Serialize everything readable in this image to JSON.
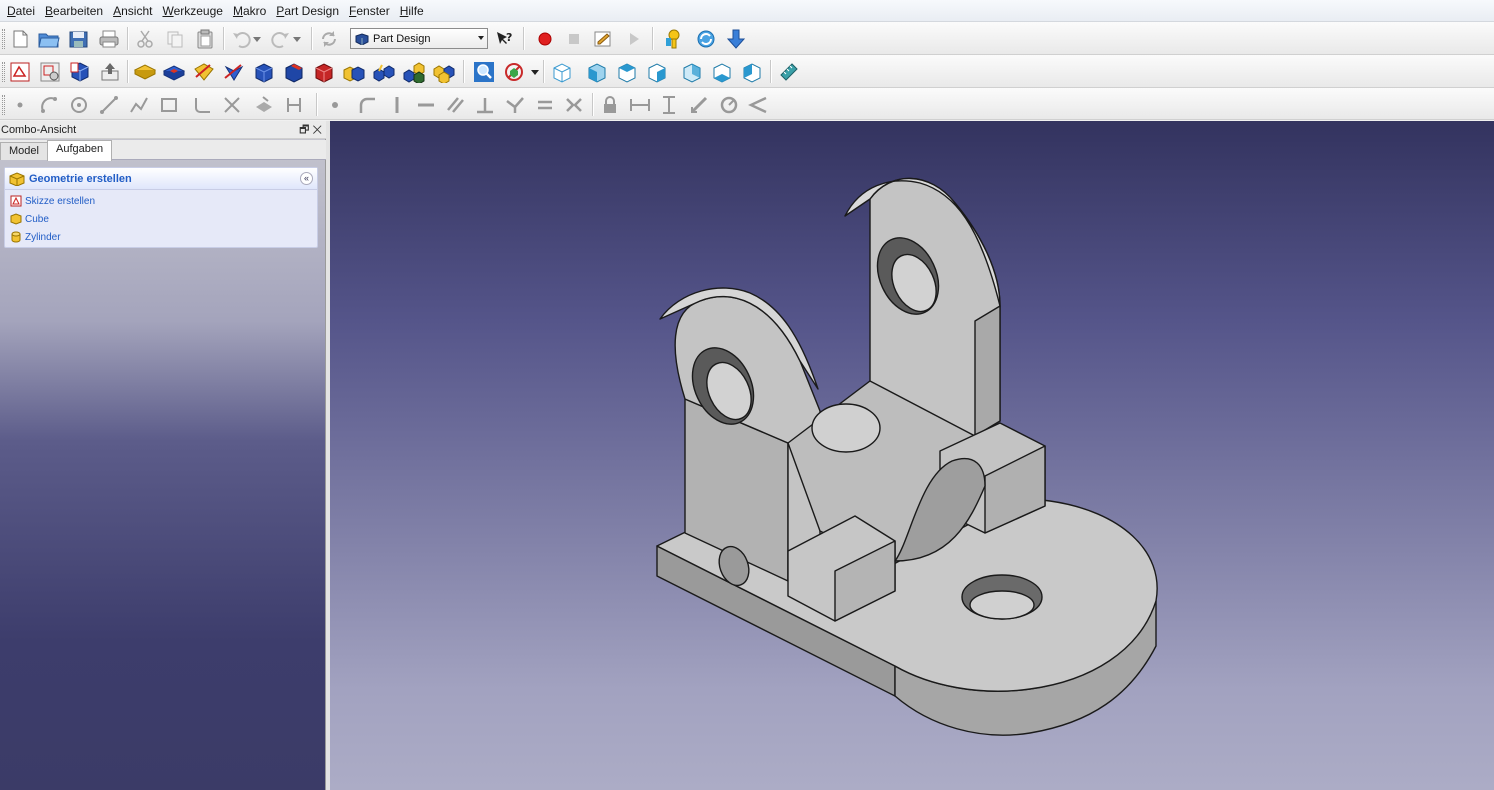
{
  "menubar": {
    "items": [
      "Datei",
      "Bearbeiten",
      "Ansicht",
      "Werkzeuge",
      "Makro",
      "Part Design",
      "Fenster",
      "Hilfe"
    ]
  },
  "toolbar": {
    "workbench": "Part Design",
    "whats_this": "?"
  },
  "combo_view": {
    "title": "Combo-Ansicht",
    "header_buttons": "🗗 ✕",
    "tabs": [
      "Model",
      "Aufgaben"
    ],
    "active_tab": "Aufgaben",
    "task_box": {
      "title": "Geometrie erstellen",
      "collapse_symbol": "«",
      "items": [
        "Skizze erstellen",
        "Cube",
        "Zylinder"
      ]
    }
  },
  "colors": {
    "viewport_top": "#33335f",
    "viewport_bottom": "#acacc6",
    "part_face": "#c9c9c9",
    "part_edge": "#1a1a1a",
    "task_link": "#215dc6"
  }
}
